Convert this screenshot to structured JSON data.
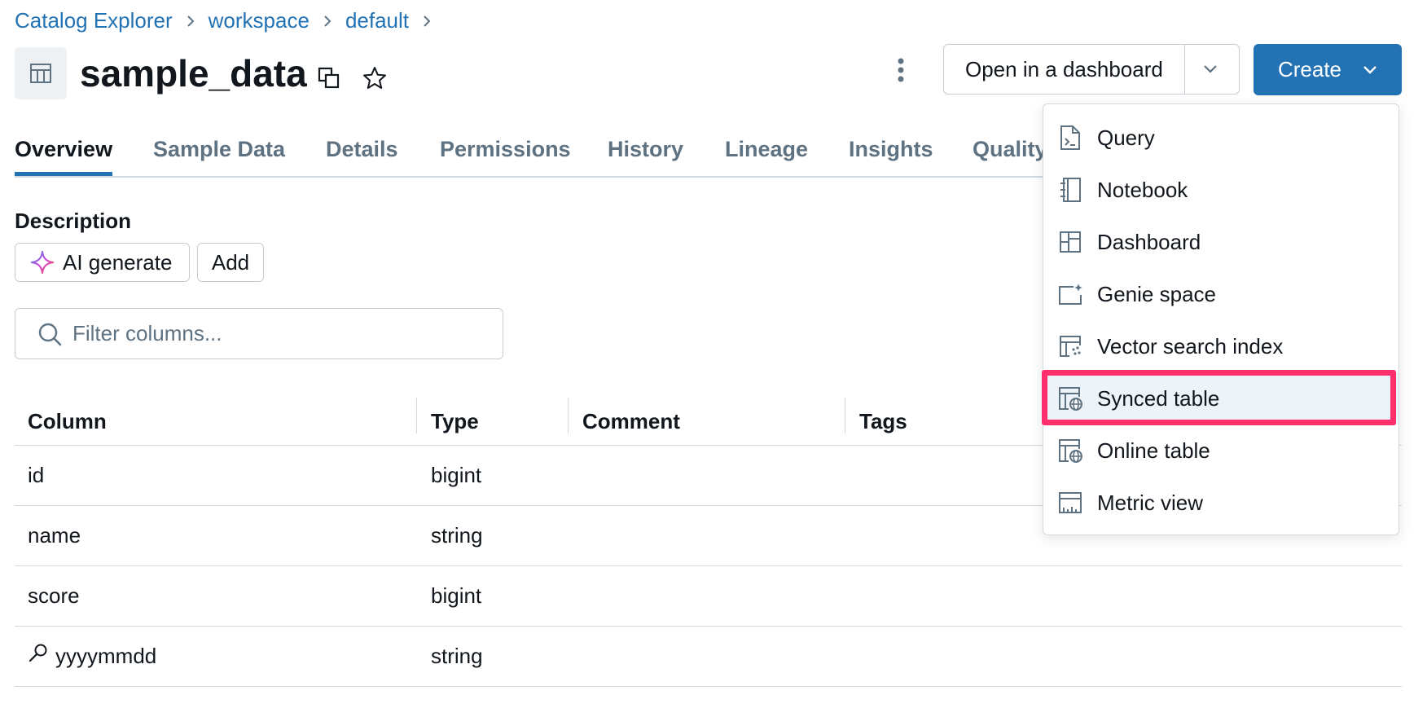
{
  "breadcrumb": [
    "Catalog Explorer",
    "workspace",
    "default"
  ],
  "title": "sample_data",
  "header": {
    "open_dashboard_label": "Open in a dashboard",
    "create_label": "Create"
  },
  "tabs": [
    "Overview",
    "Sample Data",
    "Details",
    "Permissions",
    "History",
    "Lineage",
    "Insights",
    "Quality"
  ],
  "active_tab": "Overview",
  "description": {
    "label": "Description",
    "ai_generate_label": "AI generate",
    "add_label": "Add"
  },
  "filter": {
    "placeholder": "Filter columns..."
  },
  "table": {
    "headers": [
      "Column",
      "Type",
      "Comment",
      "Tags"
    ],
    "rows": [
      {
        "column": "id",
        "type": "bigint",
        "comment": "",
        "tags": ""
      },
      {
        "column": "name",
        "type": "string",
        "comment": "",
        "tags": ""
      },
      {
        "column": "score",
        "type": "bigint",
        "comment": "",
        "tags": ""
      },
      {
        "column": "yyyymmdd",
        "type": "string",
        "comment": "",
        "tags": "",
        "icon": "partition-key-icon"
      }
    ]
  },
  "create_menu": {
    "items": [
      {
        "label": "Query",
        "icon": "query-icon"
      },
      {
        "label": "Notebook",
        "icon": "notebook-icon"
      },
      {
        "label": "Dashboard",
        "icon": "dashboard-icon"
      },
      {
        "label": "Genie space",
        "icon": "genie-space-icon"
      },
      {
        "label": "Vector search index",
        "icon": "vector-search-icon"
      },
      {
        "label": "Synced table",
        "icon": "synced-table-icon"
      },
      {
        "label": "Online table",
        "icon": "online-table-icon"
      },
      {
        "label": "Metric view",
        "icon": "metric-view-icon"
      }
    ],
    "highlighted": "Synced table"
  },
  "colors": {
    "primary": "#2272b4",
    "highlight_border": "#ff2f6e",
    "text": "#11171c",
    "secondary_text": "#5f7281",
    "border": "#d1d9e1"
  }
}
